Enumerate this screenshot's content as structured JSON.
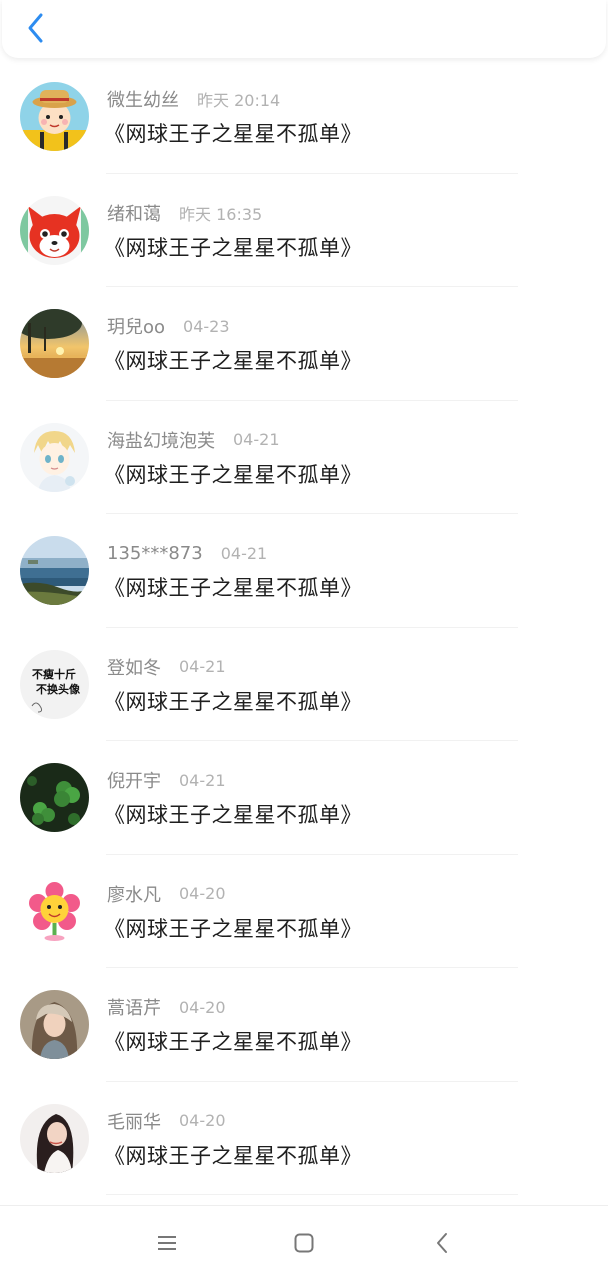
{
  "header": {
    "back_icon": "chevron-left-icon",
    "accent_color": "#2d8cf0"
  },
  "items": [
    {
      "name": "微生幼丝",
      "time": "昨天 20:14",
      "title": "《网球王子之星星不孤单》",
      "avatar": "cartoon-girl-hat"
    },
    {
      "name": "绪和蔼",
      "time": "昨天 16:35",
      "title": "《网球王子之星星不孤单》",
      "avatar": "red-fox-cartoon"
    },
    {
      "name": "玥兒oo",
      "time": "04-23",
      "title": "《网球王子之星星不孤单》",
      "avatar": "sunset-tree"
    },
    {
      "name": "海盐幻境泡芙",
      "time": "04-21",
      "title": "《网球王子之星星不孤单》",
      "avatar": "anime-boy-blonde"
    },
    {
      "name": "135***873",
      "time": "04-21",
      "title": "《网球王子之星星不孤单》",
      "avatar": "seaside-landscape"
    },
    {
      "name": "登如冬",
      "time": "04-21",
      "title": "《网球王子之星星不孤单》",
      "avatar": "text-avatar",
      "avatar_text": [
        "不瘦十斤",
        "不换头像"
      ]
    },
    {
      "name": "倪开宇",
      "time": "04-21",
      "title": "《网球王子之星星不孤单》",
      "avatar": "clover-leaves"
    },
    {
      "name": "廖水凡",
      "time": "04-20",
      "title": "《网球王子之星星不孤单》",
      "avatar": "cartoon-flower"
    },
    {
      "name": "蒿语芹",
      "time": "04-20",
      "title": "《网球王子之星星不孤单》",
      "avatar": "girl-portrait"
    },
    {
      "name": "毛丽华",
      "time": "04-20",
      "title": "《网球王子之星星不孤单》",
      "avatar": "woman-dark-hair"
    }
  ],
  "navbar": {
    "menu_icon": "menu-icon",
    "home_icon": "home-square-icon",
    "back_icon": "back-triangle-icon"
  }
}
